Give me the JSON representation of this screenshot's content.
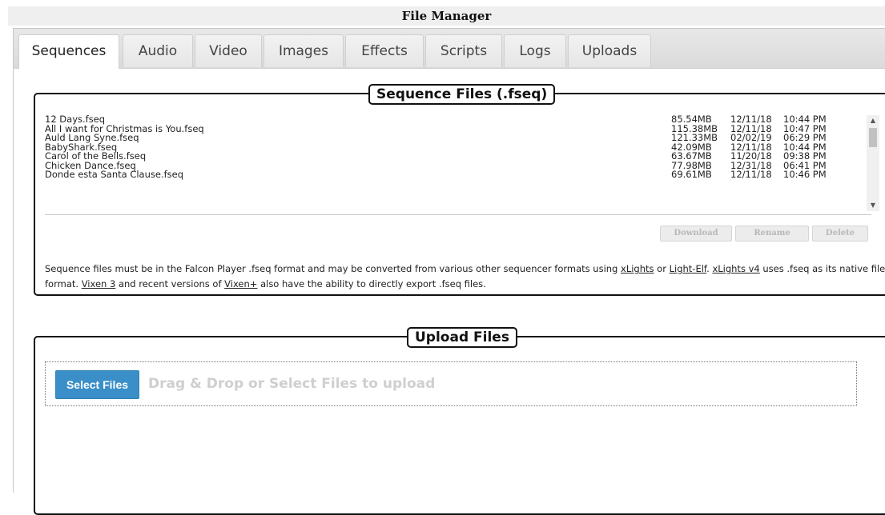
{
  "window": {
    "title": "File Manager"
  },
  "tabs": [
    {
      "label": "Sequences",
      "active": true
    },
    {
      "label": "Audio"
    },
    {
      "label": "Video"
    },
    {
      "label": "Images"
    },
    {
      "label": "Effects"
    },
    {
      "label": "Scripts"
    },
    {
      "label": "Logs"
    },
    {
      "label": "Uploads"
    }
  ],
  "sequence_panel": {
    "legend": "Sequence Files (.fseq)",
    "files": [
      {
        "name": "12 Days.fseq",
        "size": "85.54MB",
        "date": "12/11/18",
        "time": "10:44 PM"
      },
      {
        "name": "All I want for Christmas is You.fseq",
        "size": "115.38MB",
        "date": "12/11/18",
        "time": "10:47 PM"
      },
      {
        "name": "Auld Lang Syne.fseq",
        "size": "121.33MB",
        "date": "02/02/19",
        "time": "06:29 PM"
      },
      {
        "name": "BabyShark.fseq",
        "size": "42.09MB",
        "date": "12/11/18",
        "time": "10:44 PM"
      },
      {
        "name": "Carol of the Bells.fseq",
        "size": "63.67MB",
        "date": "11/20/18",
        "time": "09:38 PM"
      },
      {
        "name": "Chicken Dance.fseq",
        "size": "77.98MB",
        "date": "12/31/18",
        "time": "06:41 PM"
      },
      {
        "name": "Donde esta Santa Clause.fseq",
        "size": "69.61MB",
        "date": "12/11/18",
        "time": "10:46 PM"
      }
    ],
    "buttons": {
      "download": "Download",
      "rename": "Rename",
      "delete": "Delete"
    },
    "note": {
      "part1": "Sequence files must be in the Falcon Player .fseq format and may be converted from various other sequencer formats using ",
      "link_xlights": "xLights",
      "part2": " or ",
      "link_lightelf": "Light-Elf",
      "part3": ". ",
      "link_xlights_v4": "xLights v4",
      "part4": " uses .fseq as its native file format. ",
      "link_vixen3": "Vixen 3",
      "part5": " and recent versions of ",
      "link_vixenplus": "Vixen+",
      "part6": " also have the ability to directly export .fseq files."
    }
  },
  "upload_panel": {
    "legend": "Upload Files",
    "select_button": "Select Files",
    "hint": "Drag & Drop or Select Files to upload"
  },
  "icons": {
    "scroll_up": "triangle-up-icon",
    "scroll_down": "triangle-down-icon"
  },
  "colors": {
    "select_button": "#3a8fc9",
    "disabled_text": "#b8b8b8"
  }
}
